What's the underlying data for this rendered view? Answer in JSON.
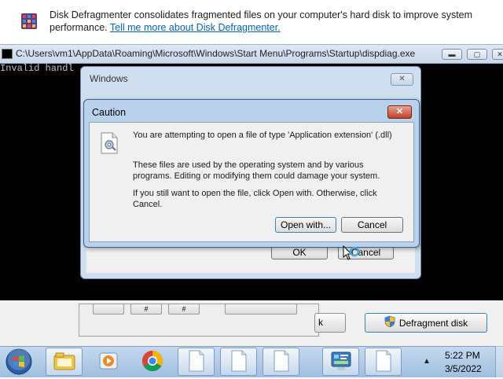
{
  "defrag": {
    "description": "Disk Defragmenter consolidates fragmented files on your computer's hard disk to improve system performance.",
    "learn_more_link": "Tell me more about Disk Defragmenter.",
    "defragment_button": "Defragment disk",
    "partial_button": "k",
    "small_button_label": "#"
  },
  "cmd": {
    "title": "C:\\Users\\vm1\\AppData\\Roaming\\Microsoft\\Windows\\Start Menu\\Programs\\Startup\\dispdiag.exe",
    "output": "Invalid handl"
  },
  "windows_dialog": {
    "title": "Windows",
    "ok_button": "OK",
    "cancel_button": "Cancel"
  },
  "caution_dialog": {
    "title": "Caution",
    "message": "You are attempting to open a file of type 'Application extension' (.dll)",
    "detail_1": "These files are used by the operating system and by various programs. Editing or modifying them could damage your system.",
    "detail_2": "If you still want to open the file, click Open with. Otherwise, click Cancel.",
    "open_with_button": "Open with...",
    "cancel_button": "Cancel"
  },
  "taskbar": {
    "time": "5:22 PM",
    "date": "3/5/2022",
    "icons": [
      "windows-start-orb",
      "file-explorer-icon",
      "media-player-icon",
      "chrome-icon",
      "blank-document-icon",
      "blank-document-icon",
      "blank-document-icon",
      "control-panel-icon",
      "blank-document-icon"
    ]
  },
  "colors": {
    "console_background": "#000000",
    "link": "#0066cc",
    "close_button_red": "#c2412a",
    "dialog_frame": "#b9d1ea"
  }
}
